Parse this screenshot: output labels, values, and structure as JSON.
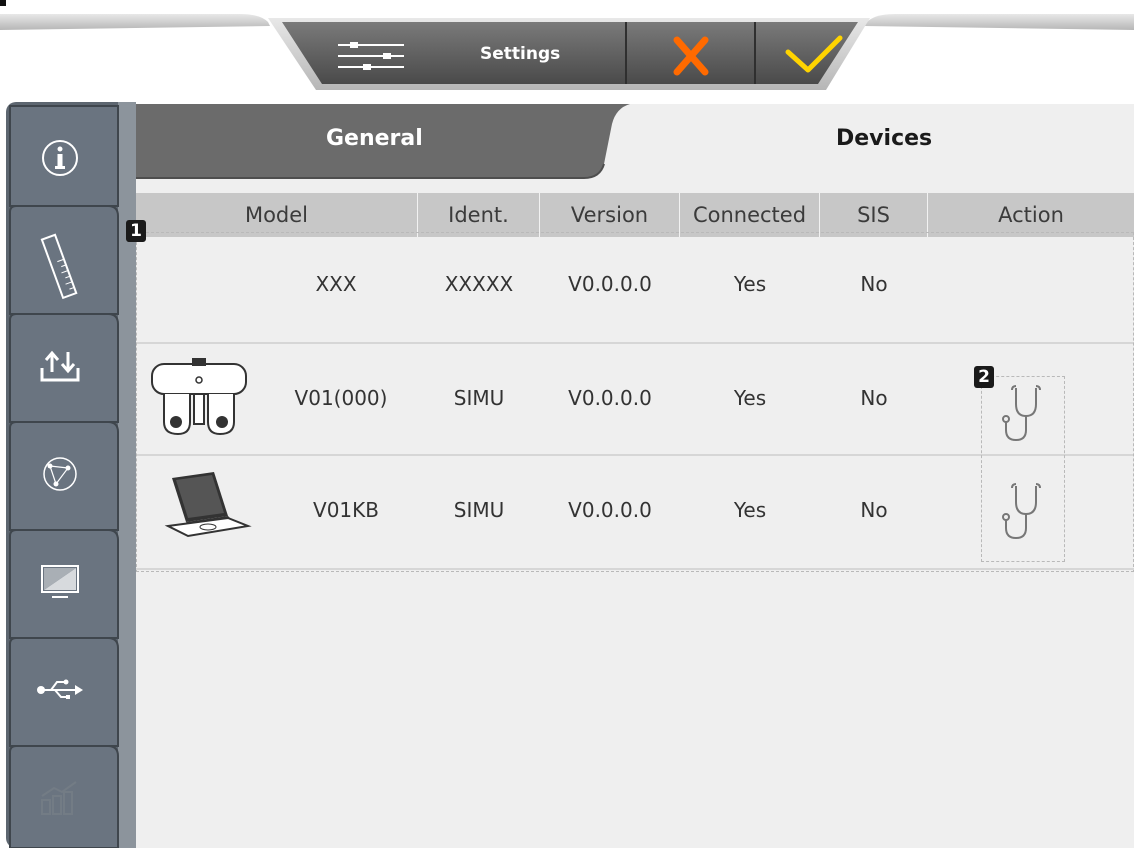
{
  "toolbar": {
    "settings_label": "Settings",
    "cancel_label": "cancel-x",
    "confirm_label": "confirm-check"
  },
  "tabs": {
    "general": "General",
    "devices": "Devices"
  },
  "table": {
    "columns": [
      "Model",
      "Ident.",
      "Version",
      "Connected",
      "SIS",
      "Action"
    ],
    "rows": [
      {
        "model": "XXX",
        "ident": "XXXXX",
        "version": "V0.0.0.0",
        "connected": "Yes",
        "sis": "No"
      },
      {
        "model": "V01(000)",
        "ident": "SIMU",
        "version": "V0.0.0.0",
        "connected": "Yes",
        "sis": "No"
      },
      {
        "model": "V01KB",
        "ident": "SIMU",
        "version": "V0.0.0.0",
        "connected": "Yes",
        "sis": "No"
      }
    ]
  },
  "badges": {
    "one": "1",
    "two": "2"
  },
  "colors": {
    "rail": "#6a7480",
    "active_tab": "#efefef",
    "inactive_tab": "#6b6b6b",
    "header": "#c7c7c7",
    "cancel": "#ff6a00",
    "confirm": "#ffd400"
  }
}
